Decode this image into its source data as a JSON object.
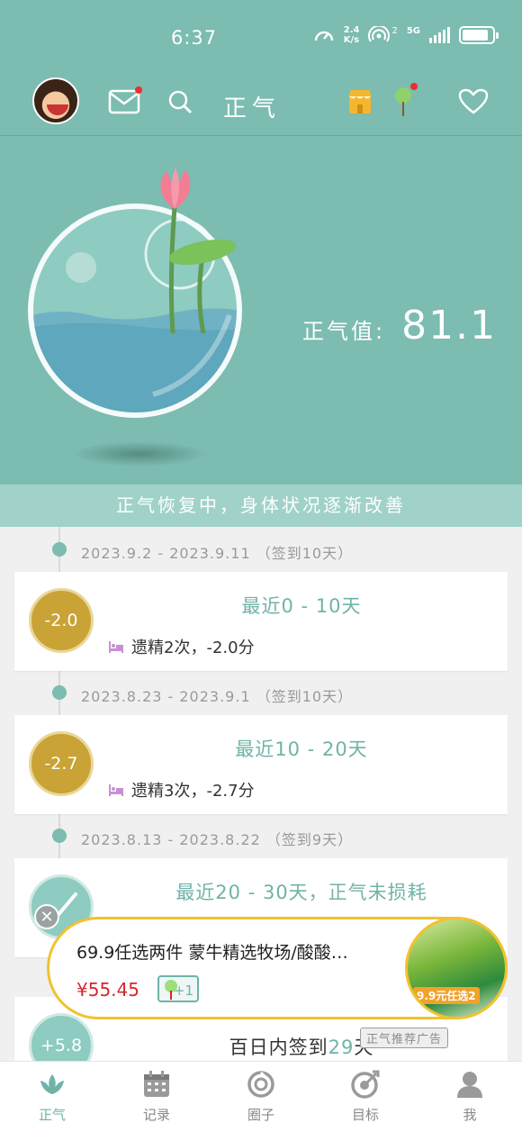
{
  "status_bar": {
    "time": "6:37",
    "net_speed_value": "2.4",
    "net_speed_unit": "K/s",
    "sim": "2",
    "network": "5G"
  },
  "header": {
    "title": "正气",
    "mail_icon": "mail-icon",
    "search_icon": "search-icon",
    "shop_icon": "shop-icon",
    "tree_icon": "tree-icon",
    "heart_icon": "heart-icon"
  },
  "hero": {
    "score_label": "正气值:",
    "score_value": "81.1",
    "status_text": "正气恢复中，身体状况逐渐改善"
  },
  "timeline": [
    {
      "date": "2023.9.2 - 2023.9.11 （签到10天）",
      "badge": "-2.0",
      "title": "最近0 - 10天",
      "detail": "遗精2次，-2.0分"
    },
    {
      "date": "2023.8.23 - 2023.9.1 （签到10天）",
      "badge": "-2.7",
      "title": "最近10 - 20天",
      "detail": "遗精3次，-2.7分"
    },
    {
      "date": "2023.8.13 - 2023.8.22 （签到9天）",
      "title": "最近20 - 30天，正气未损耗"
    },
    {
      "badge": "+5.8",
      "title_prefix": "百日内签到",
      "title_days": "29",
      "title_suffix": "天"
    }
  ],
  "ad": {
    "title": "69.9任选两件 蒙牛精选牧场/酸酸…",
    "price": "¥55.45",
    "plus": "+1",
    "image_text": "9.9元任选2",
    "label": "正气推荐广告"
  },
  "nav": [
    {
      "label": "正气",
      "active": true
    },
    {
      "label": "记录"
    },
    {
      "label": "圈子"
    },
    {
      "label": "目标"
    },
    {
      "label": "我"
    }
  ],
  "colors": {
    "teal": "#7cbcb1",
    "accent_text": "#6fb3a8",
    "badge_gold": "#c9a335",
    "ad_border": "#f1c230",
    "price_red": "#d8262f"
  }
}
